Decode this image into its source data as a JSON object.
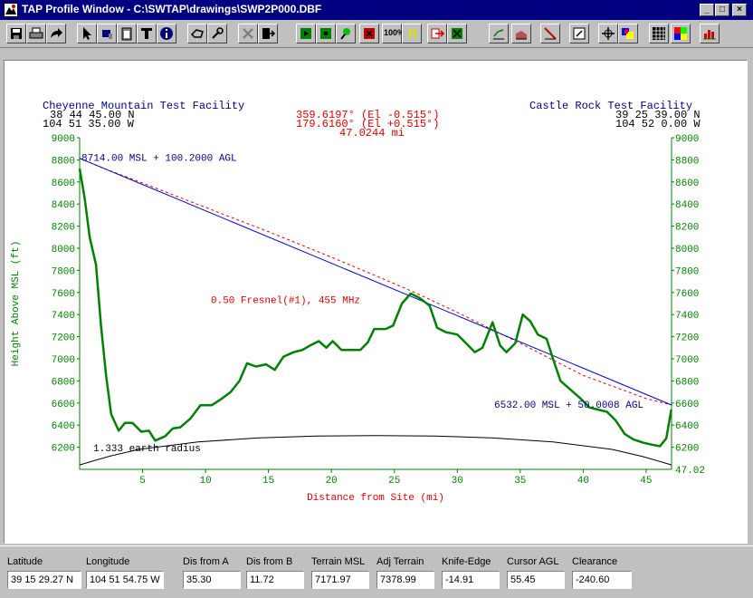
{
  "window": {
    "title": "TAP Profile Window - C:\\SWTAP\\drawings\\SWP2P000.DBF"
  },
  "toolbar": {
    "icons": [
      "save-icon",
      "print-icon",
      "redo-arrow-icon",
      "pointer-icon",
      "paint-icon",
      "clipboard-icon",
      "text-icon",
      "info-icon",
      "hand-icon",
      "wrench-icon",
      "delete-icon",
      "exit-icon",
      "green-icon-1",
      "green-icon-2",
      "green-pin-icon",
      "red-icon",
      "zoom-100-icon",
      "r-icon",
      "export-icon",
      "green-icon-3",
      "profile-line-icon",
      "profile-area-icon",
      "profile-cut-icon",
      "edit-icon",
      "move-icon",
      "palette-icon",
      "grid-icon",
      "color-grid-icon",
      "chart-icon"
    ],
    "zoom_label": "100%",
    "r_label": "R"
  },
  "header": {
    "site_a_name": "Cheyenne Mountain Test Facility",
    "site_a_lat": "38 44 45.00 N",
    "site_a_lon": "104 51 35.00 W",
    "site_b_name": "Castle Rock Test Facility",
    "site_b_lat": "39 25 39.00 N",
    "site_b_lon": "104 52 0.00 W",
    "azimuth_1": "359.6197° (El -0.515°)",
    "azimuth_2": "179.6160° (El +0.515°)",
    "distance": "47.0244 mi"
  },
  "labels": {
    "antenna_a": "8714.00 MSL + 100.2000 AGL",
    "antenna_b": "6532.00 MSL + 50.0008 AGL",
    "fresnel": "0.50 Fresnel(#1), 455 MHz",
    "earth": "1.333 earth radius",
    "end_distance": "47.02"
  },
  "chart_data": {
    "type": "line",
    "title": "",
    "xlabel": "Distance from Site (mi)",
    "ylabel": "Height Above MSL (ft)",
    "xlim": [
      0,
      47.02
    ],
    "ylim": [
      6000,
      9000
    ],
    "x_ticks": [
      5,
      10,
      15,
      20,
      25,
      30,
      35,
      40,
      45
    ],
    "y_ticks": [
      6200,
      6400,
      6600,
      6800,
      7000,
      7200,
      7400,
      7600,
      7800,
      8000,
      8200,
      8400,
      8600,
      8800,
      9000
    ],
    "colors": {
      "terrain": "#008000",
      "los": "#0000cc",
      "fresnel": "#dd0000",
      "earth": "#000000"
    },
    "series": [
      {
        "points": [
          [
            0,
            8720
          ],
          [
            0.4,
            8450
          ],
          [
            0.8,
            8100
          ],
          [
            1.3,
            7850
          ],
          [
            1.7,
            7300
          ],
          [
            2.1,
            6850
          ],
          [
            2.5,
            6500
          ],
          [
            3.1,
            6350
          ],
          [
            3.6,
            6420
          ],
          [
            4.2,
            6420
          ],
          [
            4.9,
            6340
          ],
          [
            5.5,
            6350
          ],
          [
            6,
            6260
          ],
          [
            6.8,
            6300
          ],
          [
            7.4,
            6370
          ],
          [
            8,
            6380
          ],
          [
            8.8,
            6460
          ],
          [
            9.6,
            6580
          ],
          [
            10.5,
            6580
          ],
          [
            11.3,
            6640
          ],
          [
            12,
            6700
          ],
          [
            12.7,
            6800
          ],
          [
            13.3,
            6960
          ],
          [
            14,
            6930
          ],
          [
            14.8,
            6950
          ],
          [
            15.5,
            6900
          ],
          [
            16.2,
            7020
          ],
          [
            17,
            7060
          ],
          [
            17.7,
            7080
          ],
          [
            18.3,
            7120
          ],
          [
            19,
            7160
          ],
          [
            19.6,
            7100
          ],
          [
            20.1,
            7160
          ],
          [
            20.8,
            7080
          ],
          [
            21.5,
            7080
          ],
          [
            22.3,
            7080
          ],
          [
            22.9,
            7150
          ],
          [
            23.4,
            7270
          ],
          [
            24.3,
            7270
          ],
          [
            24.9,
            7300
          ],
          [
            25.6,
            7500
          ],
          [
            26.3,
            7590
          ],
          [
            27,
            7550
          ],
          [
            27.8,
            7480
          ],
          [
            28.4,
            7280
          ],
          [
            29.1,
            7240
          ],
          [
            30,
            7220
          ],
          [
            30.7,
            7140
          ],
          [
            31.4,
            7060
          ],
          [
            32,
            7100
          ],
          [
            32.8,
            7330
          ],
          [
            33.4,
            7120
          ],
          [
            33.9,
            7060
          ],
          [
            34.6,
            7140
          ],
          [
            35.2,
            7400
          ],
          [
            35.8,
            7340
          ],
          [
            36.4,
            7220
          ],
          [
            37.1,
            7180
          ],
          [
            37.6,
            7000
          ],
          [
            38.2,
            6800
          ],
          [
            39,
            6720
          ],
          [
            39.8,
            6640
          ],
          [
            40.5,
            6560
          ],
          [
            41.2,
            6540
          ],
          [
            41.9,
            6520
          ],
          [
            42.6,
            6440
          ],
          [
            43.3,
            6320
          ],
          [
            44,
            6270
          ],
          [
            44.8,
            6240
          ],
          [
            45.6,
            6220
          ],
          [
            46.1,
            6210
          ],
          [
            46.6,
            6280
          ],
          [
            47,
            6540
          ]
        ]
      },
      {
        "points": [
          [
            0,
            8814
          ],
          [
            47.02,
            6582
          ]
        ]
      },
      {
        "points": [
          [
            0,
            8814
          ],
          [
            2,
            8720
          ],
          [
            5,
            8590
          ],
          [
            10,
            8370
          ],
          [
            15,
            8150
          ],
          [
            20,
            7920
          ],
          [
            25,
            7680
          ],
          [
            27,
            7580
          ],
          [
            30,
            7420
          ],
          [
            35,
            7140
          ],
          [
            40,
            6850
          ],
          [
            45,
            6640
          ],
          [
            47.02,
            6582
          ]
        ]
      },
      {
        "points": [
          [
            0,
            6040
          ],
          [
            2.35,
            6118
          ],
          [
            4.7,
            6180
          ],
          [
            9.4,
            6248
          ],
          [
            14.1,
            6284
          ],
          [
            18.8,
            6302
          ],
          [
            23.51,
            6306
          ],
          [
            28.2,
            6302
          ],
          [
            32.9,
            6284
          ],
          [
            37.6,
            6248
          ],
          [
            42.3,
            6180
          ],
          [
            44.67,
            6118
          ],
          [
            47.02,
            6040
          ]
        ]
      }
    ]
  },
  "status_fields": [
    {
      "label": "Latitude",
      "value": "39 15 29.27 N"
    },
    {
      "label": "Longitude",
      "value": "104 51 54.75 W"
    },
    {
      "label": "Dis from A",
      "value": "35.30"
    },
    {
      "label": "Dis from B",
      "value": "11.72"
    },
    {
      "label": "Terrain MSL",
      "value": "7171.97"
    },
    {
      "label": "Adj Terrain",
      "value": "7378.99"
    },
    {
      "label": "Knife-Edge",
      "value": "-14.91"
    },
    {
      "label": "Cursor AGL",
      "value": "55.45"
    },
    {
      "label": "Clearance",
      "value": "-240.60"
    }
  ]
}
